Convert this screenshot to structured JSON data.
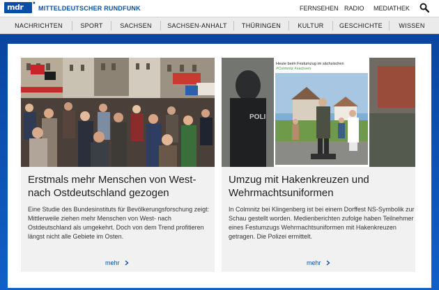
{
  "header": {
    "logo_text": "mdr",
    "brand": "MITTELDEUTSCHER RUNDFUNK",
    "links": [
      "FERNSEHEN",
      "RADIO",
      "MEDIATHEK"
    ]
  },
  "nav": {
    "items": [
      "NACHRICHTEN",
      "SPORT",
      "SACHSEN",
      "SACHSEN-ANHALT",
      "THÜRINGEN",
      "KULTUR",
      "GESCHICHTE",
      "WISSEN"
    ]
  },
  "articles": [
    {
      "title": "Erstmals mehr Menschen von West- nach Ostdeutschland gezogen",
      "teaser": "Eine Studie des Bundesinstituts für Bevölkerungsforschung zeigt: Mittlerweile ziehen mehr Menschen von West- nach Ostdeutschland als umgekehrt. Doch von dem Trend profitieren längst nicht alle Gebiete im Osten.",
      "more": "mehr"
    },
    {
      "title": "Umzug mit Hakenkreuzen und Wehrmachtsuniformen",
      "teaser": "In Colmnitz bei Klingenberg ist bei einem Dorffest NS-Symbolik zur Schau gestellt worden. Medienberichten zufolge haben Teilnehmer eines Festumzugs Wehrmachtsuniformen mit Hakenkreuzen getragen. Die Polizei ermittelt.",
      "more": "mehr",
      "image_caption": "Heute beim Festumzug im sächsischen",
      "image_hashtags": "#Colmnitz #sachsen",
      "image_police_text": "POLI"
    }
  ],
  "colors": {
    "brand_blue": "#0a4ea8",
    "stage_blue": "#0d52b0",
    "nav_bg": "#ebebeb",
    "card_bg": "#f1f1f1"
  },
  "icons": {
    "search": "search-icon",
    "chevron": "chevron-right-icon"
  }
}
